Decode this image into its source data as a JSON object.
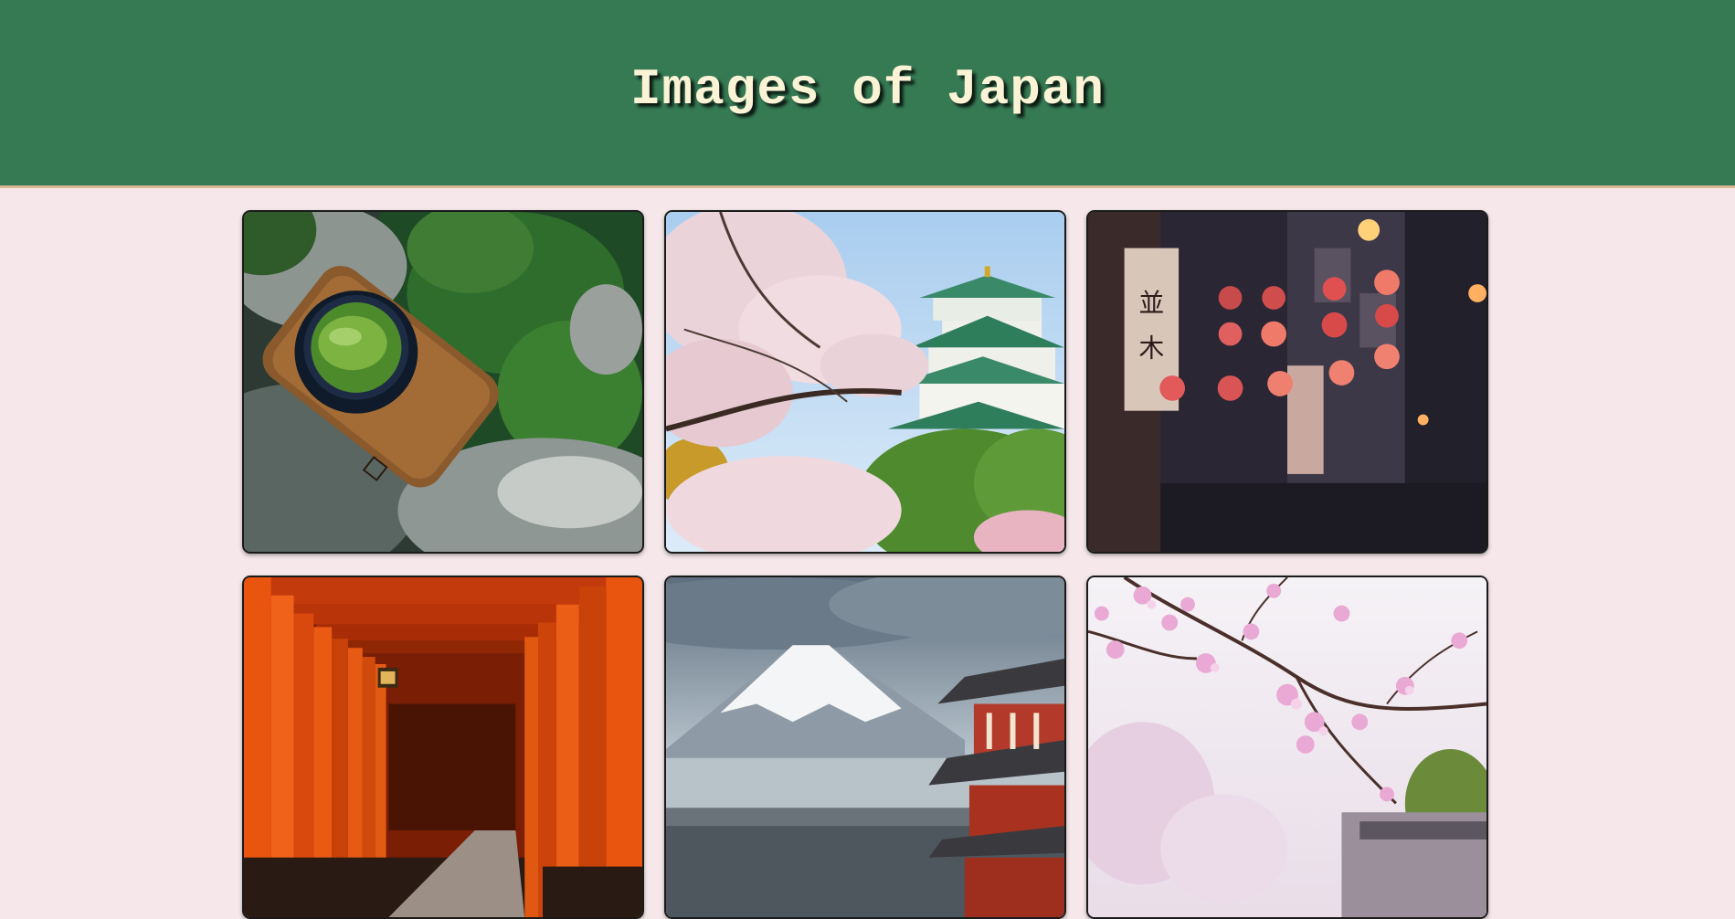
{
  "header": {
    "title": "Images of Japan",
    "background": "#367a54",
    "title_color": "#fbf3d6",
    "border_color": "#d9b895"
  },
  "page": {
    "background": "#f6e8ea"
  },
  "gallery": {
    "images": [
      {
        "subject": "matcha tea bowl on wooden tray over rocks and greenery"
      },
      {
        "subject": "cherry blossoms in front of Osaka Castle"
      },
      {
        "subject": "night alley with red paper lanterns"
      },
      {
        "subject": "Fushimi Inari red torii gate tunnel"
      },
      {
        "subject": "Mount Fuji with pagoda"
      },
      {
        "subject": "cherry blossom branches against pale sky"
      }
    ]
  }
}
